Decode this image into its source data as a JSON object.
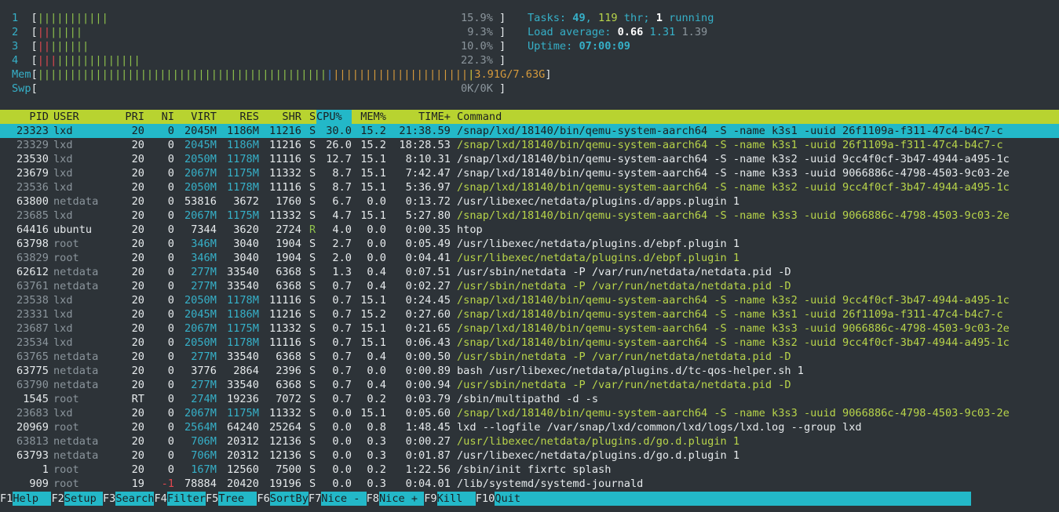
{
  "meters": {
    "cpus": [
      {
        "id": "1",
        "value": "15.9%",
        "bar": [
          [
            "green",
            "|||||||||||"
          ]
        ]
      },
      {
        "id": "2",
        "value": "9.3%",
        "bar": [
          [
            "red",
            "||"
          ],
          [
            "green",
            "|||||"
          ]
        ]
      },
      {
        "id": "3",
        "value": "10.0%",
        "bar": [
          [
            "red",
            "||"
          ],
          [
            "green",
            "||||||"
          ]
        ]
      },
      {
        "id": "4",
        "value": "22.3%",
        "bar": [
          [
            "red",
            "|||"
          ],
          [
            "green",
            "|||||||||||||"
          ]
        ]
      }
    ],
    "mem": {
      "label": "Mem",
      "value": "3.91G/7.63G"
    },
    "swp": {
      "label": "Swp",
      "value": "0K/0K"
    }
  },
  "summary": {
    "tasks_label": "Tasks:",
    "tasks": "49",
    "thr": "119",
    "thr_label": "thr;",
    "running": "1",
    "running_label": "running",
    "load_label": "Load average:",
    "load1": "0.66",
    "load5": "1.31",
    "load15": "1.39",
    "uptime_label": "Uptime:",
    "uptime": "07:00:09"
  },
  "columns": [
    "PID",
    "USER",
    "PRI",
    "NI",
    "VIRT",
    "RES",
    "SHR",
    "S",
    "CPU%",
    "MEM%",
    "TIME+",
    "Command"
  ],
  "processes": [
    {
      "pid": "23323",
      "user": "lxd",
      "pri": "20",
      "ni": "0",
      "virt": "2045M",
      "res": "1186M",
      "shr": "11216",
      "s": "S",
      "cpu": "30.0",
      "mem": "15.2",
      "time": "21:38.59",
      "cmd": "/snap/lxd/18140/bin/qemu-system-aarch64 -S -name k3s1 -uuid 26f1109a-f311-47c4-b4c7-c",
      "selected": true
    },
    {
      "pid": "23329",
      "user": "lxd",
      "pri": "20",
      "ni": "0",
      "virt": "2045M",
      "res": "1186M",
      "shr": "11216",
      "s": "S",
      "cpu": "26.0",
      "mem": "15.2",
      "time": "18:28.53",
      "cmd": "/snap/lxd/18140/bin/qemu-system-aarch64 -S -name k3s1 -uuid 26f1109a-f311-47c4-b4c7-c",
      "thread": true
    },
    {
      "pid": "23530",
      "user": "lxd",
      "pri": "20",
      "ni": "0",
      "virt": "2050M",
      "res": "1178M",
      "shr": "11116",
      "s": "S",
      "cpu": "12.7",
      "mem": "15.1",
      "time": "8:10.31",
      "cmd": "/snap/lxd/18140/bin/qemu-system-aarch64 -S -name k3s2 -uuid 9cc4f0cf-3b47-4944-a495-1c"
    },
    {
      "pid": "23679",
      "user": "lxd",
      "pri": "20",
      "ni": "0",
      "virt": "2067M",
      "res": "1175M",
      "shr": "11332",
      "s": "S",
      "cpu": "8.7",
      "mem": "15.1",
      "time": "7:42.47",
      "cmd": "/snap/lxd/18140/bin/qemu-system-aarch64 -S -name k3s3 -uuid 9066886c-4798-4503-9c03-2e"
    },
    {
      "pid": "23536",
      "user": "lxd",
      "pri": "20",
      "ni": "0",
      "virt": "2050M",
      "res": "1178M",
      "shr": "11116",
      "s": "S",
      "cpu": "8.7",
      "mem": "15.1",
      "time": "5:36.97",
      "cmd": "/snap/lxd/18140/bin/qemu-system-aarch64 -S -name k3s2 -uuid 9cc4f0cf-3b47-4944-a495-1c",
      "thread": true
    },
    {
      "pid": "63800",
      "user": "netdata",
      "pri": "20",
      "ni": "0",
      "virt": "53816",
      "res": "3672",
      "shr": "1760",
      "s": "S",
      "cpu": "6.7",
      "mem": "0.0",
      "time": "0:13.72",
      "cmd": "/usr/libexec/netdata/plugins.d/apps.plugin 1"
    },
    {
      "pid": "23685",
      "user": "lxd",
      "pri": "20",
      "ni": "0",
      "virt": "2067M",
      "res": "1175M",
      "shr": "11332",
      "s": "S",
      "cpu": "4.7",
      "mem": "15.1",
      "time": "5:27.80",
      "cmd": "/snap/lxd/18140/bin/qemu-system-aarch64 -S -name k3s3 -uuid 9066886c-4798-4503-9c03-2e",
      "thread": true
    },
    {
      "pid": "64416",
      "user": "ubuntu",
      "pri": "20",
      "ni": "0",
      "virt": "7344",
      "res": "3620",
      "shr": "2724",
      "s": "R",
      "cpu": "4.0",
      "mem": "0.0",
      "time": "0:00.35",
      "cmd": "htop",
      "own": true
    },
    {
      "pid": "63798",
      "user": "root",
      "pri": "20",
      "ni": "0",
      "virt": "346M",
      "res": "3040",
      "shr": "1904",
      "s": "S",
      "cpu": "2.7",
      "mem": "0.0",
      "time": "0:05.49",
      "cmd": "/usr/libexec/netdata/plugins.d/ebpf.plugin 1"
    },
    {
      "pid": "63829",
      "user": "root",
      "pri": "20",
      "ni": "0",
      "virt": "346M",
      "res": "3040",
      "shr": "1904",
      "s": "S",
      "cpu": "2.0",
      "mem": "0.0",
      "time": "0:04.41",
      "cmd": "/usr/libexec/netdata/plugins.d/ebpf.plugin 1",
      "thread": true
    },
    {
      "pid": "62612",
      "user": "netdata",
      "pri": "20",
      "ni": "0",
      "virt": "277M",
      "res": "33540",
      "shr": "6368",
      "s": "S",
      "cpu": "1.3",
      "mem": "0.4",
      "time": "0:07.51",
      "cmd": "/usr/sbin/netdata -P /var/run/netdata/netdata.pid -D"
    },
    {
      "pid": "63761",
      "user": "netdata",
      "pri": "20",
      "ni": "0",
      "virt": "277M",
      "res": "33540",
      "shr": "6368",
      "s": "S",
      "cpu": "0.7",
      "mem": "0.4",
      "time": "0:02.27",
      "cmd": "/usr/sbin/netdata -P /var/run/netdata/netdata.pid -D",
      "thread": true
    },
    {
      "pid": "23538",
      "user": "lxd",
      "pri": "20",
      "ni": "0",
      "virt": "2050M",
      "res": "1178M",
      "shr": "11116",
      "s": "S",
      "cpu": "0.7",
      "mem": "15.1",
      "time": "0:24.45",
      "cmd": "/snap/lxd/18140/bin/qemu-system-aarch64 -S -name k3s2 -uuid 9cc4f0cf-3b47-4944-a495-1c",
      "thread": true
    },
    {
      "pid": "23331",
      "user": "lxd",
      "pri": "20",
      "ni": "0",
      "virt": "2045M",
      "res": "1186M",
      "shr": "11216",
      "s": "S",
      "cpu": "0.7",
      "mem": "15.2",
      "time": "0:27.60",
      "cmd": "/snap/lxd/18140/bin/qemu-system-aarch64 -S -name k3s1 -uuid 26f1109a-f311-47c4-b4c7-c",
      "thread": true
    },
    {
      "pid": "23687",
      "user": "lxd",
      "pri": "20",
      "ni": "0",
      "virt": "2067M",
      "res": "1175M",
      "shr": "11332",
      "s": "S",
      "cpu": "0.7",
      "mem": "15.1",
      "time": "0:21.65",
      "cmd": "/snap/lxd/18140/bin/qemu-system-aarch64 -S -name k3s3 -uuid 9066886c-4798-4503-9c03-2e",
      "thread": true
    },
    {
      "pid": "23534",
      "user": "lxd",
      "pri": "20",
      "ni": "0",
      "virt": "2050M",
      "res": "1178M",
      "shr": "11116",
      "s": "S",
      "cpu": "0.7",
      "mem": "15.1",
      "time": "0:06.43",
      "cmd": "/snap/lxd/18140/bin/qemu-system-aarch64 -S -name k3s2 -uuid 9cc4f0cf-3b47-4944-a495-1c",
      "thread": true
    },
    {
      "pid": "63765",
      "user": "netdata",
      "pri": "20",
      "ni": "0",
      "virt": "277M",
      "res": "33540",
      "shr": "6368",
      "s": "S",
      "cpu": "0.7",
      "mem": "0.4",
      "time": "0:00.50",
      "cmd": "/usr/sbin/netdata -P /var/run/netdata/netdata.pid -D",
      "thread": true
    },
    {
      "pid": "63775",
      "user": "netdata",
      "pri": "20",
      "ni": "0",
      "virt": "3776",
      "res": "2864",
      "shr": "2396",
      "s": "S",
      "cpu": "0.7",
      "mem": "0.0",
      "time": "0:00.89",
      "cmd": "bash /usr/libexec/netdata/plugins.d/tc-qos-helper.sh 1"
    },
    {
      "pid": "63790",
      "user": "netdata",
      "pri": "20",
      "ni": "0",
      "virt": "277M",
      "res": "33540",
      "shr": "6368",
      "s": "S",
      "cpu": "0.7",
      "mem": "0.4",
      "time": "0:00.94",
      "cmd": "/usr/sbin/netdata -P /var/run/netdata/netdata.pid -D",
      "thread": true
    },
    {
      "pid": "1545",
      "user": "root",
      "pri": "RT",
      "ni": "0",
      "virt": "274M",
      "res": "19236",
      "shr": "7072",
      "s": "S",
      "cpu": "0.7",
      "mem": "0.2",
      "time": "0:03.79",
      "cmd": "/sbin/multipathd -d -s"
    },
    {
      "pid": "23683",
      "user": "lxd",
      "pri": "20",
      "ni": "0",
      "virt": "2067M",
      "res": "1175M",
      "shr": "11332",
      "s": "S",
      "cpu": "0.0",
      "mem": "15.1",
      "time": "0:05.60",
      "cmd": "/snap/lxd/18140/bin/qemu-system-aarch64 -S -name k3s3 -uuid 9066886c-4798-4503-9c03-2e",
      "thread": true
    },
    {
      "pid": "20969",
      "user": "root",
      "pri": "20",
      "ni": "0",
      "virt": "2564M",
      "res": "64240",
      "shr": "25264",
      "s": "S",
      "cpu": "0.0",
      "mem": "0.8",
      "time": "1:48.45",
      "cmd": "lxd --logfile /var/snap/lxd/common/lxd/logs/lxd.log --group lxd"
    },
    {
      "pid": "63813",
      "user": "netdata",
      "pri": "20",
      "ni": "0",
      "virt": "706M",
      "res": "20312",
      "shr": "12136",
      "s": "S",
      "cpu": "0.0",
      "mem": "0.3",
      "time": "0:00.27",
      "cmd": "/usr/libexec/netdata/plugins.d/go.d.plugin 1",
      "thread": true
    },
    {
      "pid": "63793",
      "user": "netdata",
      "pri": "20",
      "ni": "0",
      "virt": "706M",
      "res": "20312",
      "shr": "12136",
      "s": "S",
      "cpu": "0.0",
      "mem": "0.3",
      "time": "0:01.87",
      "cmd": "/usr/libexec/netdata/plugins.d/go.d.plugin 1"
    },
    {
      "pid": "1",
      "user": "root",
      "pri": "20",
      "ni": "0",
      "virt": "167M",
      "res": "12560",
      "shr": "7500",
      "s": "S",
      "cpu": "0.0",
      "mem": "0.2",
      "time": "1:22.56",
      "cmd": "/sbin/init fixrtc splash"
    },
    {
      "pid": "909",
      "user": "root",
      "pri": "19",
      "ni": "-1",
      "virt": "78884",
      "res": "20420",
      "shr": "19196",
      "s": "S",
      "cpu": "0.0",
      "mem": "0.3",
      "time": "0:04.01",
      "cmd": "/lib/systemd/systemd-journald"
    }
  ],
  "footer": [
    {
      "key": "F1",
      "label": "Help  "
    },
    {
      "key": "F2",
      "label": "Setup "
    },
    {
      "key": "F3",
      "label": "Search"
    },
    {
      "key": "F4",
      "label": "Filter"
    },
    {
      "key": "F5",
      "label": "Tree  "
    },
    {
      "key": "F6",
      "label": "SortBy"
    },
    {
      "key": "F7",
      "label": "Nice - "
    },
    {
      "key": "F8",
      "label": "Nice + "
    },
    {
      "key": "F9",
      "label": "Kill  "
    },
    {
      "key": "F10",
      "label": "Quit"
    }
  ],
  "colors": {
    "background": "#2d3338",
    "accent_cyan": "#23b8c8",
    "header_green": "#b8d330"
  }
}
